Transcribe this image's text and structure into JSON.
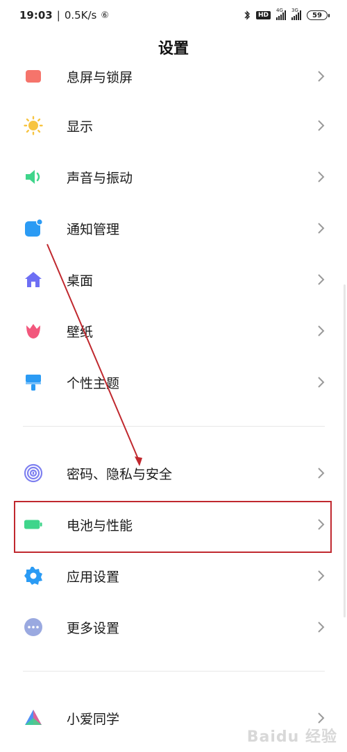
{
  "status_bar": {
    "time": "19:03",
    "speed": "0.5K/s",
    "hd": "HD",
    "sig1_tag": "4G",
    "sig2_tag": "3G",
    "battery": "59"
  },
  "page_title": "设置",
  "items": [
    {
      "label": "息屏与锁屏",
      "icon": "lock-screen-icon",
      "color": "#f5746b"
    },
    {
      "label": "显示",
      "icon": "sun-icon",
      "color": "#f7c441"
    },
    {
      "label": "声音与振动",
      "icon": "speaker-icon",
      "color": "#3fd58b"
    },
    {
      "label": "通知管理",
      "icon": "notification-icon",
      "color": "#2b9bf4"
    },
    {
      "label": "桌面",
      "icon": "home-icon",
      "color": "#6d6ff4"
    },
    {
      "label": "壁纸",
      "icon": "tulip-icon",
      "color": "#f2577c"
    },
    {
      "label": "个性主题",
      "icon": "paint-brush-icon",
      "color": "#2b9bf4"
    },
    {
      "label": "密码、隐私与安全",
      "icon": "fingerprint-icon",
      "color": "#7e80f0"
    },
    {
      "label": "电池与性能",
      "icon": "battery-icon",
      "color": "#3fd58b"
    },
    {
      "label": "应用设置",
      "icon": "gear-icon",
      "color": "#2b9bf4"
    },
    {
      "label": "更多设置",
      "icon": "more-dots-icon",
      "color": "#9aa9e0"
    },
    {
      "label": "小爱同学",
      "icon": "xiaoai-icon",
      "color": "#4f8ff5"
    }
  ],
  "watermark": "Baidu 经验"
}
